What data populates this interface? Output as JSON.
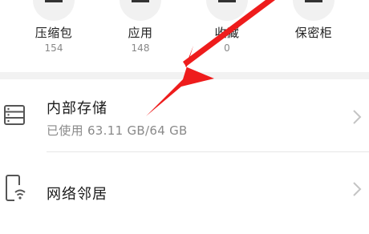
{
  "categories": [
    {
      "label": "压缩包",
      "count": "154",
      "icon": "archive-icon"
    },
    {
      "label": "应用",
      "count": "148",
      "icon": "apps-icon"
    },
    {
      "label": "收藏",
      "count": "0",
      "icon": "favorites-icon"
    },
    {
      "label": "保密柜",
      "count": "",
      "icon": "safe-icon"
    }
  ],
  "storage": {
    "title": "内部存储",
    "usage": "已使用 63.11 GB/64 GB",
    "icon": "storage-icon"
  },
  "network": {
    "title": "网络邻居",
    "icon": "network-device-icon"
  },
  "colors": {
    "annotation_arrow": "#ee1c1c",
    "separator": "#e6e6e6",
    "band": "#f2f2f2"
  }
}
